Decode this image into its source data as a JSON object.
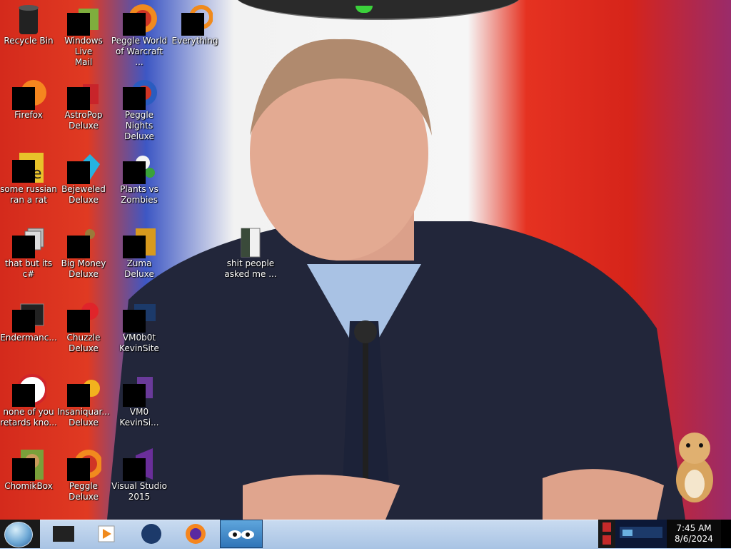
{
  "desktop": {
    "icons": [
      {
        "label": "Recycle Bin",
        "icon": "recycle-bin-icon"
      },
      {
        "label": "Windows Live\nMail",
        "icon": "mail-icon"
      },
      {
        "label": "Peggle World\nof Warcraft ...",
        "icon": "peggle-icon"
      },
      {
        "label": "Everything",
        "icon": "search-icon"
      },
      {
        "label": "Firefox",
        "icon": "firefox-icon"
      },
      {
        "label": "AstroPop\nDeluxe",
        "icon": "game-icon"
      },
      {
        "label": "Peggle Nights\nDeluxe",
        "icon": "peggle-icon"
      },
      {
        "label": "some russian\nran a rat",
        "icon": "file-icon"
      },
      {
        "label": "Bejeweled\nDeluxe",
        "icon": "gem-icon"
      },
      {
        "label": "Plants vs\nZombies",
        "icon": "plant-icon"
      },
      {
        "label": "that but its c#",
        "icon": "file-icon"
      },
      {
        "label": "Big Money\nDeluxe",
        "icon": "game-icon"
      },
      {
        "label": "Zuma Deluxe",
        "icon": "game-icon"
      },
      {
        "label": "shit people\nasked me ...",
        "icon": "folder-icon"
      },
      {
        "label": "Endermanc...",
        "icon": "app-icon"
      },
      {
        "label": "Chuzzle\nDeluxe",
        "icon": "game-icon"
      },
      {
        "label": "VM0b0t\nKevinSite",
        "icon": "app-icon"
      },
      {
        "label": "none of you\nretards kno...",
        "icon": "app-icon"
      },
      {
        "label": "Insaniquar...\nDeluxe",
        "icon": "game-icon"
      },
      {
        "label": "VM0\nKevinSi...",
        "icon": "app-icon"
      },
      {
        "label": "ChomikBox",
        "icon": "hamster-icon"
      },
      {
        "label": "Peggle Deluxe",
        "icon": "peggle-icon"
      },
      {
        "label": "Visual Studio\n2015",
        "icon": "visual-studio-icon"
      }
    ]
  },
  "taskbar": {
    "start_icon": "windows-start-icon",
    "pinned": [
      {
        "name": "media-center-icon"
      },
      {
        "name": "media-player-icon"
      },
      {
        "name": "globe-icon"
      },
      {
        "name": "firefox-icon"
      },
      {
        "name": "eyes-app-icon"
      }
    ],
    "clock": {
      "time": "7:45 AM",
      "date": "8/6/2024"
    }
  },
  "colors": {
    "taskbar": "#b6cde9",
    "flag_red": "#d8281c",
    "flag_blue": "#3d57c4"
  }
}
